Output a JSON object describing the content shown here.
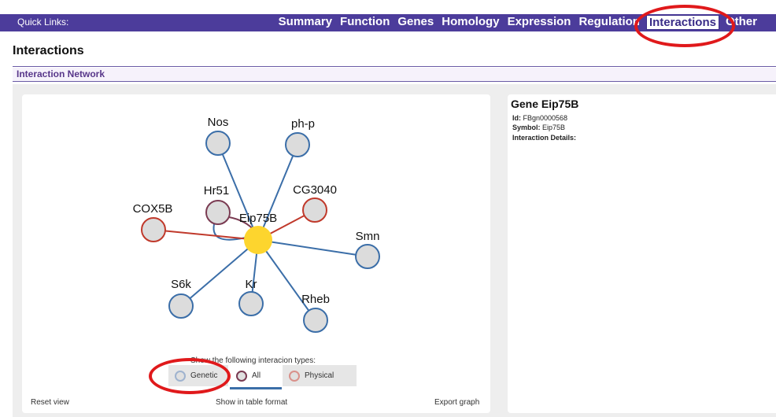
{
  "quick_links": {
    "label": "Quick Links:",
    "items": [
      "Summary",
      "Function",
      "Genes",
      "Homology",
      "Expression",
      "Regulation",
      "Interactions",
      "Other"
    ],
    "active": "Interactions"
  },
  "section_title": "Interactions",
  "subsection_title": "Interaction Network",
  "network": {
    "center": {
      "label": "Eip75B",
      "color": "#fdd52e"
    },
    "nodes": [
      {
        "label": "Nos",
        "type": "genetic"
      },
      {
        "label": "ph-p",
        "type": "genetic"
      },
      {
        "label": "Hr51",
        "type": "all"
      },
      {
        "label": "CG3040",
        "type": "physical"
      },
      {
        "label": "COX5B",
        "type": "physical"
      },
      {
        "label": "Smn",
        "type": "genetic"
      },
      {
        "label": "S6k",
        "type": "genetic"
      },
      {
        "label": "Kr",
        "type": "genetic"
      },
      {
        "label": "Rheb",
        "type": "genetic"
      }
    ],
    "colors": {
      "genetic": "#3b6ea8",
      "physical": "#c0392b",
      "all": "#7a3b52"
    }
  },
  "legend": {
    "title": "Show the following interacion types:",
    "options": [
      {
        "label": "Genetic",
        "color": "#9fb3cf"
      },
      {
        "label": "All",
        "color": "#7a3b52"
      },
      {
        "label": "Physical",
        "color": "#d9918b"
      }
    ]
  },
  "footer": {
    "reset": "Reset view",
    "table": "Show in table format",
    "export": "Export graph"
  },
  "info": {
    "title": "Gene Eip75B",
    "id_label": "Id:",
    "id_value": "FBgn0000568",
    "symbol_label": "Symbol:",
    "symbol_value": "Eip75B",
    "details_label": "Interaction Details:"
  }
}
